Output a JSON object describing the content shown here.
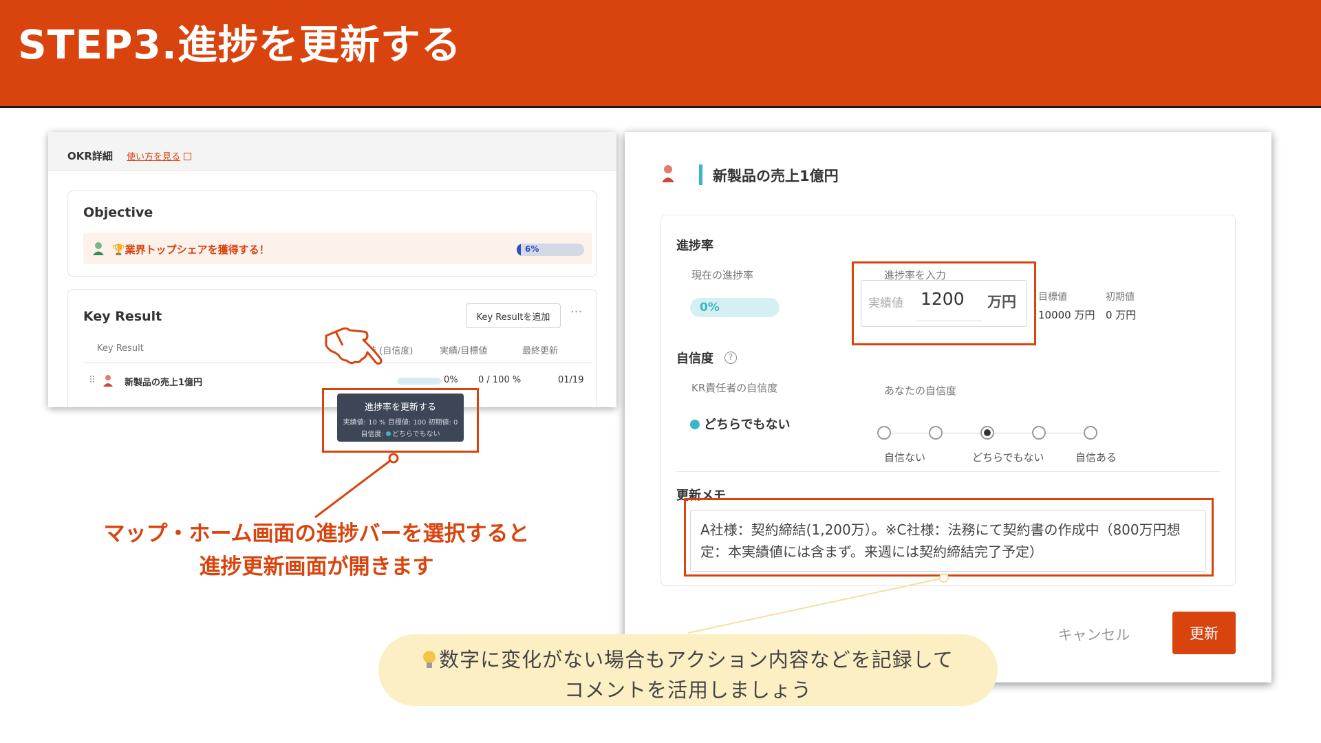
{
  "slide": {
    "title": "STEP3.進捗を更新する"
  },
  "okr_panel": {
    "header_title": "OKR詳細",
    "howto_link": "使い方を見る",
    "objective": {
      "heading": "Objective",
      "text": "🏆業界トップシェアを獲得する！",
      "progress_label": "6%",
      "progress_fraction": 0.06
    },
    "key_result": {
      "heading": "Key Result",
      "add_button": "Key Resultを追加",
      "more_icon": "more-icon",
      "columns": [
        "Key Result",
        "進捗 (自信度)",
        "実績/目標値",
        "最終更新"
      ],
      "row": {
        "name": "新製品の売上1億円",
        "progress": "0%",
        "actual_target": "0 / 100 %",
        "updated": "01/19"
      }
    },
    "tooltip": {
      "title": "進捗率を更新する",
      "detail": "実績値: 10 % 目標値: 100 初期値: 0",
      "confidence_prefix": "自信度:",
      "confidence_value": "どちらでもない"
    }
  },
  "callout": {
    "line1": "マップ・ホーム画面の進捗バーを選択すると",
    "line2": "進捗更新画面が開きます"
  },
  "dialog": {
    "title": "新製品の売上1億円",
    "progress_section": {
      "label": "進捗率",
      "current_label": "現在の進捗率",
      "current_value": "0%",
      "input_label": "進捗率を入力",
      "input_placeholder": "実績値",
      "input_value": "1200",
      "input_unit": "万円",
      "target_label": "目標値",
      "target_value": "10000 万円",
      "initial_label": "初期値",
      "initial_value": "0 万円"
    },
    "confidence_section": {
      "label": "自信度",
      "help_icon": "help-icon",
      "kr_owner_label": "KR責任者の自信度",
      "kr_owner_value": "どちらでもない",
      "your_label": "あなたの自信度",
      "options_labels": [
        "自信ない",
        "どちらでもない",
        "自信ある"
      ],
      "selected_index": 2
    },
    "memo_section": {
      "label": "更新メモ",
      "value": "A社様：契約締結(1,200万）。※C社様：法務にて契約書の作成中（800万円想定：本実績値には含まず。来週には契約締結完了予定）"
    },
    "buttons": {
      "cancel": "キャンセル",
      "update": "更新"
    }
  },
  "tip": {
    "line1": "数字に変化がない場合もアクション内容などを記録して",
    "line2": "コメントを活用しましょう"
  },
  "colors": {
    "accent": "#d9430e",
    "teal": "#3ab5c9",
    "tip_bg": "#fcefc4",
    "objective_bar": "#2a4fc0"
  }
}
